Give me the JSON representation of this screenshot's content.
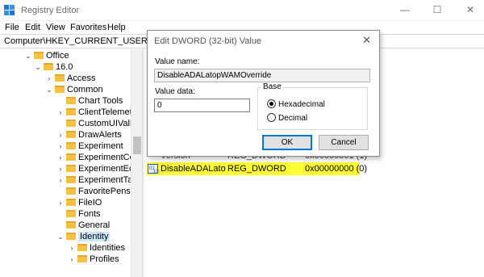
{
  "window": {
    "title": "Registry Editor",
    "minimize_glyph": "—",
    "maximize_glyph": "☐",
    "close_glyph": "✕"
  },
  "menu": [
    "File",
    "Edit",
    "View",
    "Favorites",
    "Help"
  ],
  "address": "Computer\\HKEY_CURRENT_USER\\Software",
  "tree": [
    {
      "label": "Office",
      "chev": "⌄"
    },
    {
      "label": "16.0",
      "chev": "⌄"
    },
    {
      "label": "Access",
      "chev": "›"
    },
    {
      "label": "Common",
      "chev": "⌄"
    },
    {
      "label": "Chart Tools",
      "chev": ""
    },
    {
      "label": "ClientTelemetry",
      "chev": "›"
    },
    {
      "label": "CustomUIValida",
      "chev": ""
    },
    {
      "label": "DrawAlerts",
      "chev": "›"
    },
    {
      "label": "Experiment",
      "chev": "›"
    },
    {
      "label": "ExperimentCor",
      "chev": "›"
    },
    {
      "label": "ExperimentEcs",
      "chev": "›"
    },
    {
      "label": "ExperimentTas",
      "chev": "›"
    },
    {
      "label": "FavoritePens",
      "chev": ""
    },
    {
      "label": "FileIO",
      "chev": "›"
    },
    {
      "label": "Fonts",
      "chev": ""
    },
    {
      "label": "General",
      "chev": ""
    },
    {
      "label": "Identity",
      "chev": "⌄"
    },
    {
      "label": "Identities",
      "chev": "›"
    },
    {
      "label": "Profiles",
      "chev": "›"
    }
  ],
  "list": {
    "partial_row": {
      "name": "Version",
      "type": "REG_DWORD",
      "data": "0x00000001 (1)"
    },
    "selected_row": {
      "name": "DisableADALato",
      "type": "REG_DWORD",
      "data": "0x00000000 (0)"
    }
  },
  "dialog": {
    "title": "Edit DWORD (32-bit) Value",
    "close_glyph": "✕",
    "value_name_label": "Value name:",
    "value_name": "DisableADALatopWAMOverride",
    "value_data_label": "Value data:",
    "value_data": "0",
    "base_label": "Base",
    "hex_label": "Hexadecimal",
    "dec_label": "Decimal",
    "selected_base": "Hexadecimal",
    "ok_label": "OK",
    "cancel_label": "Cancel"
  },
  "colors": {
    "highlight": "#ffff33",
    "accent": "#0078d7",
    "folder": "#f5c242"
  }
}
